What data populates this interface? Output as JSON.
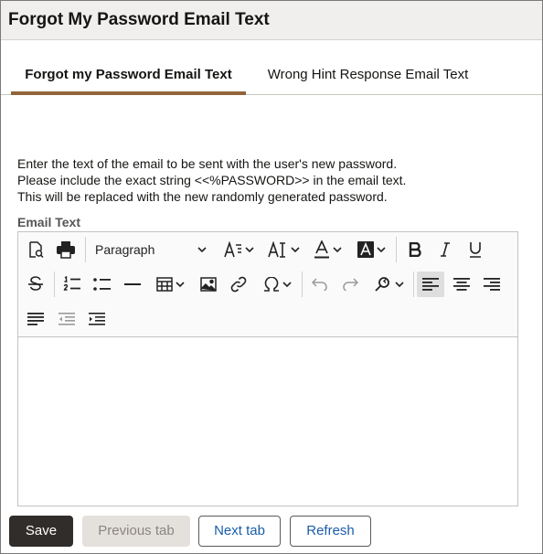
{
  "page": {
    "title": "Forgot My Password Email Text"
  },
  "tabs": [
    {
      "label": "Forgot my Password Email Text",
      "selected": true
    },
    {
      "label": "Wrong Hint Response Email Text",
      "selected": false
    }
  ],
  "instructions": [
    "Enter the text of the email to be sent with the user's new password.",
    "Please include the exact string <<%PASSWORD>> in the email text.",
    "This will be replaced with the new randomly generated password."
  ],
  "editor": {
    "label": "Email Text",
    "block_format": "Paragraph",
    "content": "",
    "toolbar_icons": [
      "preview-icon",
      "print-icon",
      "font-family-icon",
      "font-size-icon",
      "text-color-icon",
      "background-color-icon",
      "bold-icon",
      "italic-icon",
      "underline-icon",
      "strikethrough-icon",
      "numbered-list-icon",
      "bullet-list-icon",
      "horizontal-line-icon",
      "table-icon",
      "image-icon",
      "link-icon",
      "special-character-icon",
      "undo-icon",
      "redo-icon",
      "find-replace-icon",
      "align-left-icon",
      "align-center-icon",
      "align-right-icon",
      "justify-icon",
      "outdent-icon",
      "indent-icon"
    ]
  },
  "buttons": {
    "save": "Save",
    "previous": "Previous tab",
    "next": "Next tab",
    "refresh": "Refresh"
  },
  "colors": {
    "title_bar_bg": "#f1efed",
    "tab_underline": "#92643d",
    "primary_button": "#312d2a",
    "link_text": "#1a5dab",
    "disabled_button": "#e4e1dd"
  }
}
